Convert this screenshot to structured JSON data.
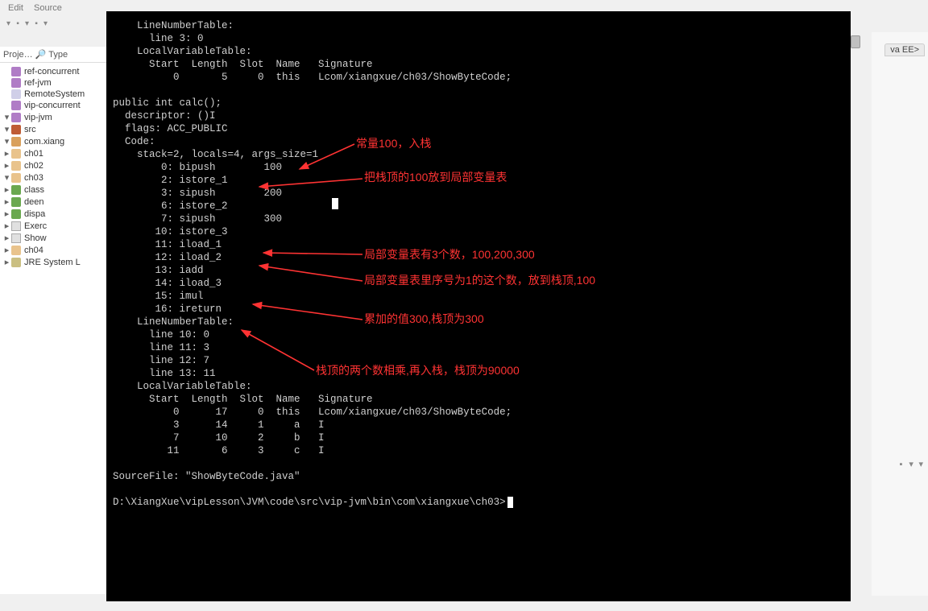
{
  "menu": {
    "edit": "Edit",
    "source": "Source"
  },
  "sidebar": {
    "heading": "Proje… 🔎 Type",
    "items": [
      {
        "depth": 0,
        "icon": "ico-proj",
        "twist": "",
        "label": "ref-concurrent"
      },
      {
        "depth": 0,
        "icon": "ico-proj",
        "twist": "",
        "label": "ref-jvm"
      },
      {
        "depth": 0,
        "icon": "ico-projc",
        "twist": "",
        "label": "RemoteSystem"
      },
      {
        "depth": 0,
        "icon": "ico-proj",
        "twist": "",
        "label": "vip-concurrent"
      },
      {
        "depth": 0,
        "icon": "ico-proj",
        "twist": "v",
        "label": "vip-jvm"
      },
      {
        "depth": 1,
        "icon": "ico-src",
        "twist": "v",
        "label": "src"
      },
      {
        "depth": 2,
        "icon": "ico-pkg",
        "twist": "v",
        "label": "com.xiang"
      },
      {
        "depth": 3,
        "icon": "ico-pkgc",
        "twist": ">",
        "label": "ch01"
      },
      {
        "depth": 3,
        "icon": "ico-pkgc",
        "twist": ">",
        "label": "ch02"
      },
      {
        "depth": 3,
        "icon": "ico-pkgc",
        "twist": "v",
        "label": "ch03"
      },
      {
        "depth": 4,
        "icon": "ico-cls",
        "twist": ">",
        "label": "class"
      },
      {
        "depth": 4,
        "icon": "ico-cls",
        "twist": ">",
        "label": "deen"
      },
      {
        "depth": 4,
        "icon": "ico-cls",
        "twist": ">",
        "label": "dispa"
      },
      {
        "depth": 4,
        "icon": "ico-file",
        "twist": ">",
        "label": "Exerc"
      },
      {
        "depth": 4,
        "icon": "ico-file",
        "twist": ">",
        "label": "Show"
      },
      {
        "depth": 3,
        "icon": "ico-pkgc",
        "twist": ">",
        "label": "ch04"
      },
      {
        "depth": 1,
        "icon": "ico-jre",
        "twist": ">",
        "label": "JRE System L"
      }
    ]
  },
  "console": {
    "pre": "    LineNumberTable:\n      line 3: 0\n    LocalVariableTable:\n      Start  Length  Slot  Name   Signature\n          0       5     0  this   Lcom/xiangxue/ch03/ShowByteCode;\n\npublic int calc();\n  descriptor: ()I\n  flags: ACC_PUBLIC\n  Code:\n    stack=2, locals=4, args_size=1\n        0: bipush        100\n        2: istore_1\n        3: sipush        200\n        6: istore_2\n        7: sipush        300\n       10: istore_3\n       11: iload_1\n       12: iload_2\n       13: iadd\n       14: iload_3\n       15: imul\n       16: ireturn\n    LineNumberTable:\n      line 10: 0\n      line 11: 3\n      line 12: 7\n      line 13: 11\n    LocalVariableTable:\n      Start  Length  Slot  Name   Signature\n          0      17     0  this   Lcom/xiangxue/ch03/ShowByteCode;\n          3      14     1     a   I\n          7      10     2     b   I\n         11       6     3     c   I\n\nSourceFile: \"ShowByteCode.java\"\n",
    "prompt": "D:\\XiangXue\\vipLesson\\JVM\\code\\src\\vip-jvm\\bin\\com\\xiangxue\\ch03>"
  },
  "annotations": {
    "a1": "常量100，入栈",
    "a2": "把栈顶的100放到局部变量表",
    "a3": "局部变量表有3个数，100,200,300",
    "a4": "局部变量表里序号为1的这个数，放到栈顶,100",
    "a5": "累加的值300,栈顶为300",
    "a6": "栈顶的两个数相乘,再入栈，栈顶为90000"
  },
  "right": {
    "tab": "va EE>"
  }
}
